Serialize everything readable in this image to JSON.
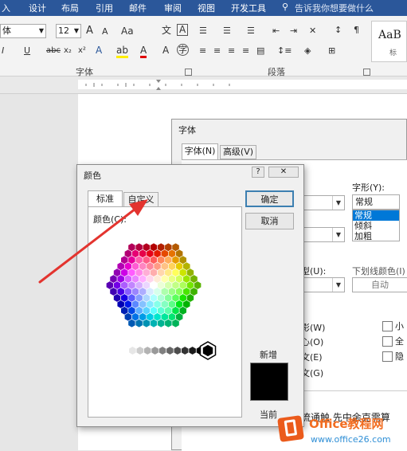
{
  "ribbon": {
    "tabs": [
      "入",
      "设计",
      "布局",
      "引用",
      "邮件",
      "审阅",
      "视图",
      "开发工具"
    ],
    "tell_me": "告诉我你想要做什么",
    "font_name": "体",
    "font_size": "12",
    "font_grow": "A",
    "font_shrink": "A",
    "change_case": "Aa",
    "styles_preview": "AaB",
    "styles_sub": "标",
    "group_font": "字体",
    "group_paragraph": "段落"
  },
  "font_dialog": {
    "title": "字体",
    "tab_font": "字体(N)",
    "tab_advanced": "高级(V)",
    "style_label": "字形(Y):",
    "style_value": "常规",
    "style_options": [
      "常规",
      "倾斜",
      "加粗"
    ],
    "underline_type_label": "型(U):",
    "underline_color_label": "下划线颜色(I)",
    "underline_color_value": "自动",
    "effects": [
      "影(W)",
      "心(O)",
      "文(E)",
      "文(G)"
    ],
    "checks_right": [
      "小",
      "全",
      "隐"
    ],
    "preview_text": "流通触  先中余克需算"
  },
  "color_dialog": {
    "title": "颜色",
    "help_label": "?",
    "close_label": "✕",
    "tab_standard": "标准",
    "tab_custom": "自定义",
    "colors_label": "颜色(C):",
    "ok_label": "确定",
    "cancel_label": "取消",
    "new_label": "新增",
    "current_label": "当前",
    "new_color": "#000000"
  },
  "watermark": {
    "brand": "Office教程网",
    "url": "www.office26.com"
  }
}
